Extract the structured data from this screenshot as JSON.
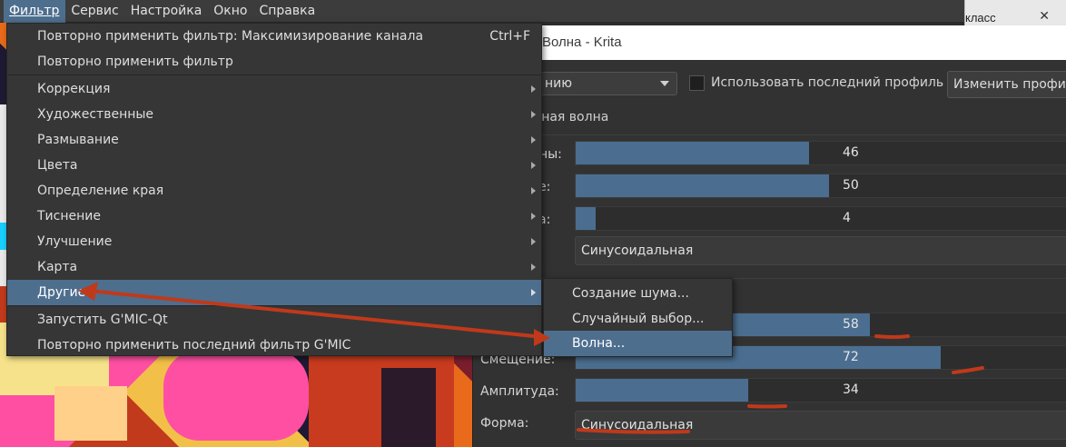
{
  "menubar": {
    "items": [
      {
        "label": "Фильтр",
        "active": true
      },
      {
        "label": "Сервис"
      },
      {
        "label": "Настройка"
      },
      {
        "label": "Окно"
      },
      {
        "label": "Справка"
      }
    ]
  },
  "taskbar_fragment": {
    "text": "класс"
  },
  "filter_menu": {
    "reapply_named": "Повторно применить фильтр: Максимизирование канала",
    "reapply_named_shortcut": "Ctrl+F",
    "reapply": "Повторно применить фильтр",
    "categories": [
      "Коррекция",
      "Художественные",
      "Размывание",
      "Цвета",
      "Определение края",
      "Тиснение",
      "Улучшение",
      "Карта",
      "Другие"
    ],
    "gmic_start": "Запустить G'MIC-Qt",
    "gmic_reapply": "Повторно применить последний фильтр G'MIC"
  },
  "submenu": {
    "items": [
      "Создание шума...",
      "Случайный выбор...",
      "Волна..."
    ]
  },
  "dialog": {
    "title": "Волна - Krita",
    "profile_combo": "нию",
    "use_last_profile": "Использовать последний профиль",
    "edit_profiles": "Изменить профил",
    "section_vertical": "льная волна",
    "vertical": {
      "label1": "лны:",
      "value1": "46",
      "fraction1": 0.46,
      "label2": "е:",
      "value2": "50",
      "fraction2": 0.5,
      "label3": "а:",
      "value3": "4",
      "fraction3": 0.04,
      "shape": "Синусоидальная"
    },
    "horizontal": {
      "wavelength_value": "58",
      "wavelength_fraction": 0.58,
      "shift_label": "Смещение:",
      "shift_value": "72",
      "shift_fraction": 0.72,
      "amplitude_label": "Амплитуда:",
      "amplitude_value": "34",
      "amplitude_fraction": 0.34,
      "shape_label": "Форма:",
      "shape": "Синусоидальная"
    }
  },
  "colors": {
    "accent": "#4e6e8e",
    "slider_fill": "#4b6e90",
    "annotation": "#c0391b"
  }
}
